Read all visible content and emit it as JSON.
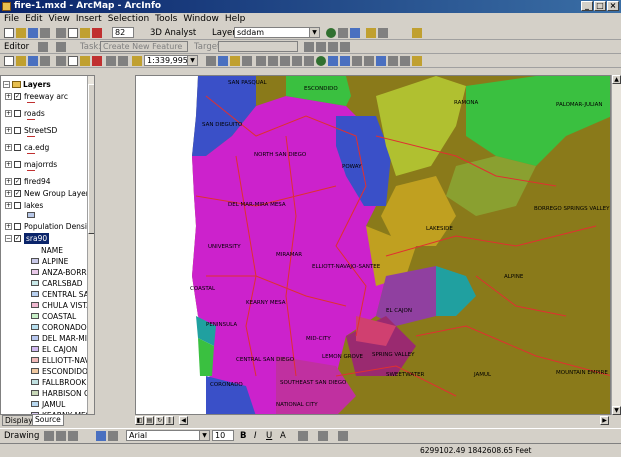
{
  "window": {
    "title": "fire-1.mxd - ArcMap - ArcInfo",
    "controls": [
      "_",
      "□",
      "×"
    ]
  },
  "menu": [
    "File",
    "Edit",
    "View",
    "Insert",
    "Selection",
    "Tools",
    "Window",
    "Help"
  ],
  "toolbar1": {
    "zoom": "82",
    "analyst_label": "3D Analyst",
    "layer_label": "Layer:",
    "layer_value": "sddam"
  },
  "toolbar2": {
    "editor_label": "Editor",
    "task_label": "Task:",
    "task_value": "Create New Feature",
    "target_label": "Target:",
    "target_value": ""
  },
  "toolbar3": {
    "scale": "1:339,995"
  },
  "toc": {
    "root": "Layers",
    "layers": [
      {
        "name": "freeway arc",
        "checked": true,
        "symbol": "line"
      },
      {
        "name": "roads",
        "checked": false,
        "symbol": "line"
      },
      {
        "name": "StreetSD",
        "checked": false,
        "symbol": "line"
      },
      {
        "name": "ca.edg",
        "checked": false,
        "symbol": "line"
      },
      {
        "name": "majorrds",
        "checked": false,
        "symbol": "line"
      },
      {
        "name": "fired94",
        "checked": true,
        "symbol": "none"
      },
      {
        "name": "New Group Layer",
        "checked": true,
        "symbol": "none"
      },
      {
        "name": "lakes",
        "checked": false,
        "symbol": "fill"
      },
      {
        "name": "Population Densit",
        "checked": false,
        "symbol": "none"
      },
      {
        "name": "sra90",
        "checked": true,
        "symbol": "none",
        "selected": true
      }
    ],
    "field_header": "NAME",
    "legend": [
      {
        "label": "ALPINE",
        "color": "#c8c8e8"
      },
      {
        "label": "ANZA-BORREG",
        "color": "#e8c8e8"
      },
      {
        "label": "CARLSBAD",
        "color": "#c8e8e8"
      },
      {
        "label": "CENTRAL SAN",
        "color": "#b8d0f0"
      },
      {
        "label": "CHULA VISTA",
        "color": "#f0b8d0"
      },
      {
        "label": "COASTAL",
        "color": "#c8f0c8"
      },
      {
        "label": "CORONADO",
        "color": "#b8e0f0"
      },
      {
        "label": "DEL MAR-MIRA",
        "color": "#b8c8f0"
      },
      {
        "label": "EL CAJON",
        "color": "#d0b8f0"
      },
      {
        "label": "ELLIOTT-NAVA",
        "color": "#f0b8b8"
      },
      {
        "label": "ESCONDIDO",
        "color": "#f0c8a0"
      },
      {
        "label": "FALLBROOK",
        "color": "#c0e0e0"
      },
      {
        "label": "HARBISON CRE",
        "color": "#c8d8b8"
      },
      {
        "label": "JAMUL",
        "color": "#b8d8f0"
      },
      {
        "label": "KEARNY MESA",
        "color": "#d8c8f0"
      }
    ],
    "tabs": [
      "Display",
      "Source"
    ]
  },
  "map": {
    "labels": [
      "SAN DIEGUITO",
      "ESCONDIDO",
      "SAN PASQUAL",
      "PALOMAR-JULIAN",
      "NORTH SAN DIEGO",
      "RAMONA",
      "POWAY",
      "DEL MAR-MIRA MESA",
      "BORREGO SPRINGS VALLEY",
      "UNIVERSITY",
      "LAKESIDE",
      "MIRAMAR",
      "ELLIOTT-NAVAJO-SANTEE",
      "ALPINE",
      "COASTAL",
      "KEARNY MESA",
      "EL CAJON",
      "PENINSULA",
      "MID-CITY",
      "CENTRAL SAN DIEGO",
      "LEMON GROVE",
      "SPRING VALLEY",
      "SOUTHEAST SAN DIEGO",
      "SWEETWATER",
      "NATIONAL CITY",
      "CORONADO",
      "JAMUL",
      "MOUNTAIN EMPIRE"
    ],
    "colors": {
      "ocean": "#ffffff",
      "magenta": "#cc22cc",
      "olive": "#8a7a1a",
      "blue": "#3a50c8",
      "gold": "#c0a020",
      "teal": "#20a0a0",
      "green": "#3ac040",
      "roads": "#e03030"
    }
  },
  "drawing": {
    "label": "Drawing",
    "font": "Arial",
    "size": "10",
    "bold": "B",
    "italic": "I",
    "underline": "U",
    "text": "A"
  },
  "status": {
    "coords": "6299102.49  1842608.65 Feet"
  }
}
